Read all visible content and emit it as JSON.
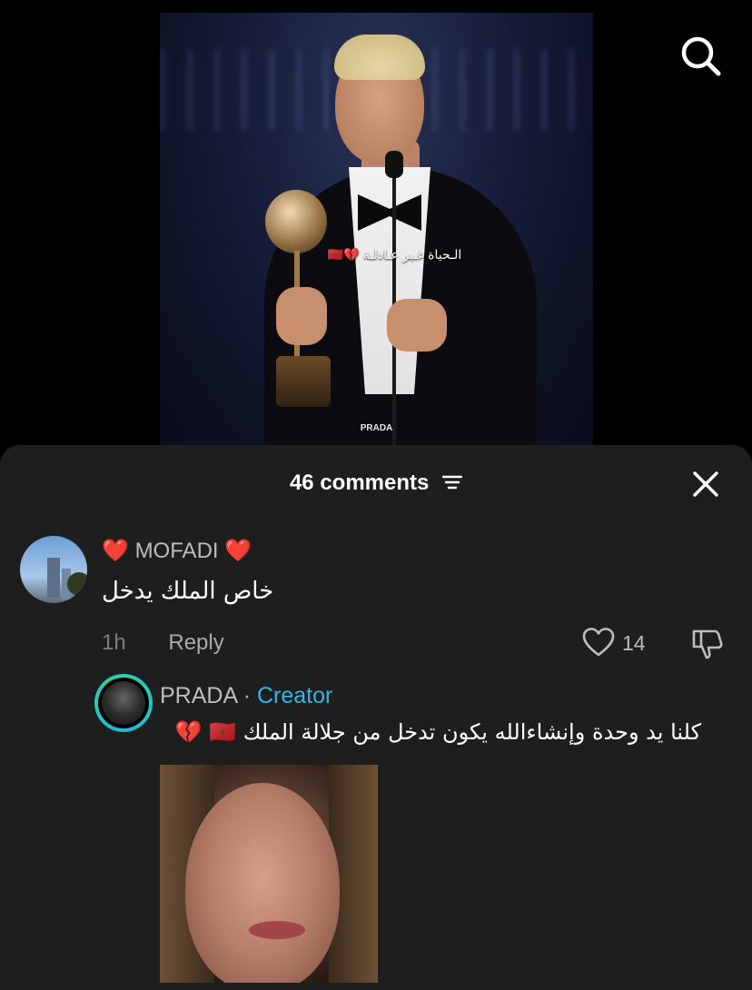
{
  "video": {
    "caption": "الـحياة غـير عـادلـة 💔🇲🇦",
    "watermark": "PRADA"
  },
  "icons": {
    "search": "search-icon",
    "close": "close-icon",
    "filter": "sort-filter-icon",
    "like": "heart-outline-icon",
    "dislike": "thumbs-down-icon"
  },
  "comments_sheet": {
    "title": "46 comments",
    "comments": [
      {
        "username": "MOFADI",
        "username_prefix": "❤️",
        "username_suffix": "❤️",
        "text": "خاص الملك يدخل",
        "time": "1h",
        "reply_label": "Reply",
        "likes": "14"
      }
    ],
    "reply": {
      "username": "PRADA",
      "separator": " · ",
      "badge": "Creator",
      "text": "كلنا يد وحدة وإنشاءالله يكون تدخل من جلالة الملك 🇲🇦 💔"
    }
  },
  "colors": {
    "sheet_bg": "#1e1e1f",
    "creator_badge": "#2fb7e6",
    "heart": "#e8202a"
  }
}
